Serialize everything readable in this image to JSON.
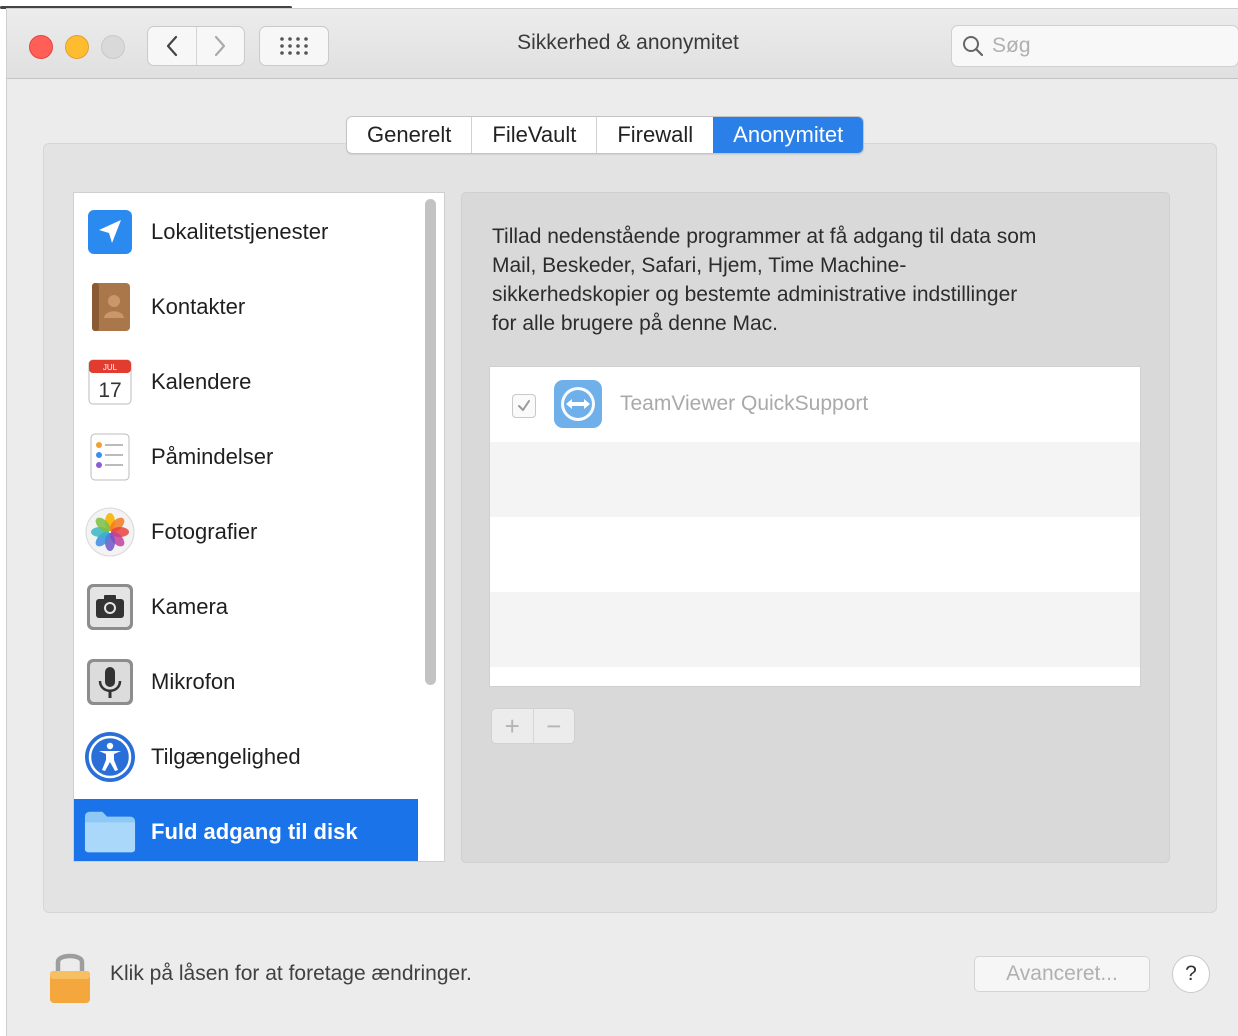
{
  "window": {
    "title": "Sikkerhed & anonymitet"
  },
  "nav": {
    "back_icon": "chevron-left-icon",
    "forward_icon": "chevron-right-icon",
    "grid_icon": "show-all-grid-icon"
  },
  "search": {
    "placeholder": "Søg"
  },
  "tabs": [
    {
      "label": "Generelt",
      "active": false
    },
    {
      "label": "FileVault",
      "active": false
    },
    {
      "label": "Firewall",
      "active": false
    },
    {
      "label": "Anonymitet",
      "active": true
    }
  ],
  "sidebar": {
    "items": [
      {
        "label": "Lokalitetstjenester",
        "icon": "location-arrow-icon"
      },
      {
        "label": "Kontakter",
        "icon": "contacts-book-icon"
      },
      {
        "label": "Kalendere",
        "icon": "calendar-icon",
        "icon_text_month": "JUL",
        "icon_text_day": "17"
      },
      {
        "label": "Påmindelser",
        "icon": "reminders-icon"
      },
      {
        "label": "Fotografier",
        "icon": "photos-flower-icon"
      },
      {
        "label": "Kamera",
        "icon": "camera-icon"
      },
      {
        "label": "Mikrofon",
        "icon": "microphone-icon"
      },
      {
        "label": "Tilgængelighed",
        "icon": "accessibility-icon"
      },
      {
        "label": "Fuld adgang til disk",
        "icon": "folder-icon",
        "selected": true
      }
    ]
  },
  "main": {
    "description": "Tillad nedenstående programmer at få adgang til data som Mail, Beskeder, Safari, Hjem, Time Machine-sikkerhedskopier og bestemte administrative indstillinger for alle brugere på denne Mac.",
    "description_lines": [
      "Tillad nedenstående programmer at få adgang til data som",
      "Mail, Beskeder, Safari, Hjem, Time Machine-",
      "sikkerhedskopier og bestemte administrative indstillinger",
      "for alle brugere på denne Mac."
    ],
    "apps": [
      {
        "name": "TeamViewer QuickSupport",
        "checked": true,
        "icon": "teamviewer-icon"
      }
    ],
    "add_label": "+",
    "remove_label": "−"
  },
  "footer": {
    "lock_text": "Klik på låsen for at foretage ændringer.",
    "advanced_label": "Avanceret...",
    "help_label": "?"
  },
  "colors": {
    "accent": "#2a7fe8",
    "selection": "#1a73e8",
    "close": "#ff5f57",
    "minimize": "#febc2e"
  }
}
